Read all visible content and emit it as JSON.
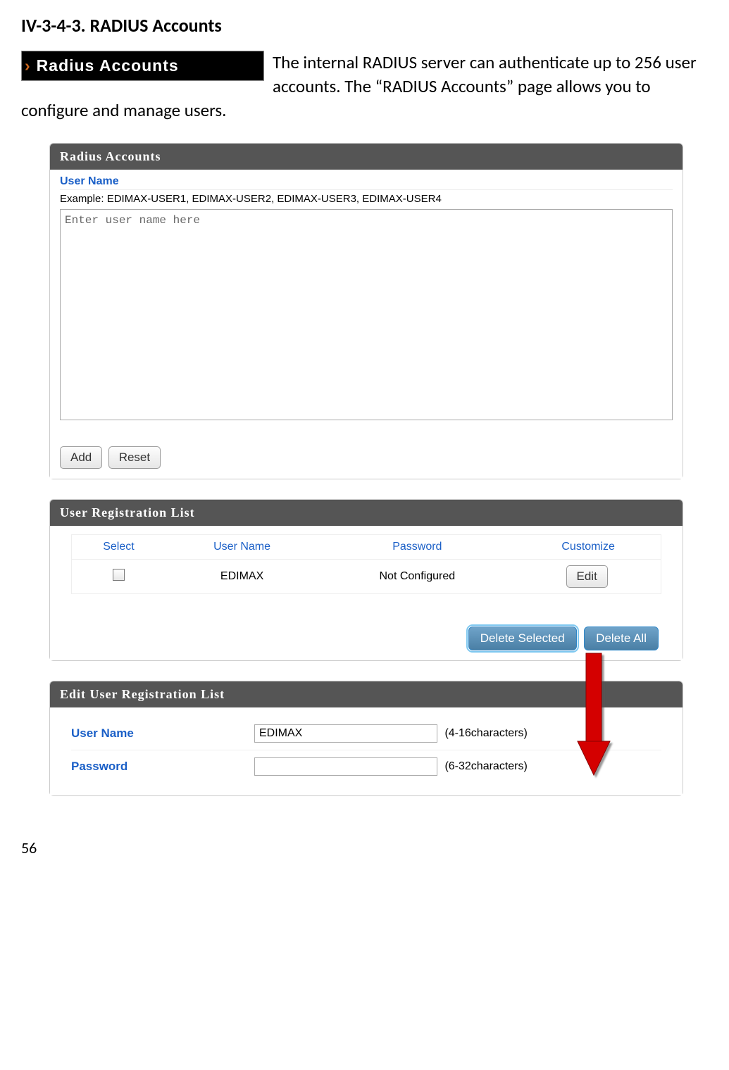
{
  "heading": "IV-3-4-3.    RADIUS Accounts",
  "nav_badge_label": "Radius Accounts",
  "intro_text": "The internal RADIUS server can authenticate up to 256 user accounts. The “RADIUS Accounts” page allows you to configure and manage users.",
  "panel1": {
    "title": "Radius Accounts",
    "username_label": "User Name",
    "example_text": "Example: EDIMAX-USER1, EDIMAX-USER2, EDIMAX-USER3, EDIMAX-USER4",
    "textarea_value": "Enter user name here",
    "add_label": "Add",
    "reset_label": "Reset"
  },
  "panel2": {
    "title": "User Registration List",
    "columns": {
      "select": "Select",
      "username": "User Name",
      "password": "Password",
      "customize": "Customize"
    },
    "row": {
      "username": "EDIMAX",
      "password": "Not Configured",
      "edit_label": "Edit"
    },
    "delete_selected_label": "Delete Selected",
    "delete_all_label": "Delete All"
  },
  "panel3": {
    "title": "Edit User Registration List",
    "username_label": "User Name",
    "username_value": "EDIMAX",
    "username_hint": "(4-16characters)",
    "password_label": "Password",
    "password_value": "",
    "password_hint": "(6-32characters)"
  },
  "page_number": "56"
}
